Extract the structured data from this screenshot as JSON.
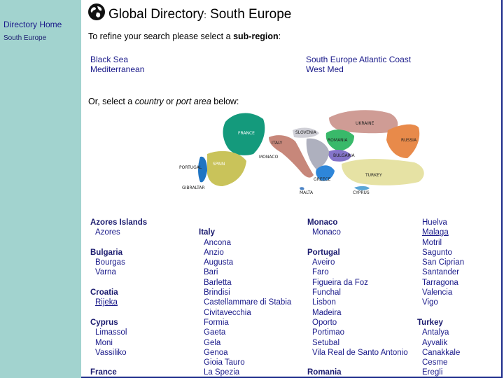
{
  "sidebar": {
    "home_label": "Directory Home",
    "current_label": "South Europe"
  },
  "header": {
    "title_main": "Global Directory",
    "title_sep": ":",
    "title_region": " South Europe"
  },
  "instructions": {
    "subregion_prefix": "To refine your search please select a ",
    "subregion_bold": "sub-region",
    "subregion_suffix": ":",
    "country_prefix": "Or, select a ",
    "country_em1": "country",
    "country_mid": " or ",
    "country_em2": "port area",
    "country_suffix": " below:"
  },
  "subregions": [
    "Black Sea",
    "Mediterranean",
    "South Europe Atlantic Coast",
    "West Med"
  ],
  "map_labels": [
    "UKRAINE",
    "FRANCE",
    "SLOVENIA",
    "ROMANIA",
    "RUSSIA",
    "ITALY",
    "BULGARIA",
    "MONACO",
    "PORTUGAL",
    "SPAIN",
    "GREECE",
    "TURKEY",
    "GIBRALTAR",
    "MALTA",
    "CYPRUS"
  ],
  "columns": [
    [
      {
        "type": "country",
        "text": "Azores Islands"
      },
      {
        "type": "port",
        "text": "Azores"
      },
      {
        "type": "gap"
      },
      {
        "type": "country",
        "text": "Bulgaria"
      },
      {
        "type": "port",
        "text": "Bourgas"
      },
      {
        "type": "port",
        "text": "Varna"
      },
      {
        "type": "gap"
      },
      {
        "type": "country",
        "text": "Croatia"
      },
      {
        "type": "port",
        "text": "Rijeka",
        "underline": true
      },
      {
        "type": "gap"
      },
      {
        "type": "country",
        "text": "Cyprus"
      },
      {
        "type": "port",
        "text": "Limassol"
      },
      {
        "type": "port",
        "text": "Moni"
      },
      {
        "type": "port",
        "text": "Vassiliko"
      },
      {
        "type": "gap"
      },
      {
        "type": "country",
        "text": "France"
      }
    ],
    [
      {
        "type": "gap"
      },
      {
        "type": "country",
        "text": "Italy"
      },
      {
        "type": "port",
        "text": "Ancona"
      },
      {
        "type": "port",
        "text": "Anzio"
      },
      {
        "type": "port",
        "text": "Augusta"
      },
      {
        "type": "port",
        "text": "Bari"
      },
      {
        "type": "port",
        "text": "Barletta"
      },
      {
        "type": "port",
        "text": "Brindisi"
      },
      {
        "type": "port",
        "text": "Castellammare di Stabia"
      },
      {
        "type": "port",
        "text": "Civitavecchia"
      },
      {
        "type": "port",
        "text": "Formia"
      },
      {
        "type": "port",
        "text": "Gaeta"
      },
      {
        "type": "port",
        "text": "Gela"
      },
      {
        "type": "port",
        "text": "Genoa"
      },
      {
        "type": "port",
        "text": "Gioia Tauro"
      },
      {
        "type": "port",
        "text": "La Spezia"
      }
    ],
    [
      {
        "type": "country",
        "text": "Monaco"
      },
      {
        "type": "port",
        "text": "Monaco"
      },
      {
        "type": "gap"
      },
      {
        "type": "country",
        "text": "Portugal"
      },
      {
        "type": "port",
        "text": "Aveiro"
      },
      {
        "type": "port",
        "text": "Faro"
      },
      {
        "type": "port",
        "text": "Figueira da Foz"
      },
      {
        "type": "port",
        "text": "Funchal"
      },
      {
        "type": "port",
        "text": "Lisbon"
      },
      {
        "type": "port",
        "text": "Madeira"
      },
      {
        "type": "port",
        "text": "Oporto"
      },
      {
        "type": "port",
        "text": "Portimao"
      },
      {
        "type": "port",
        "text": "Setubal"
      },
      {
        "type": "port",
        "text": "Vila Real de Santo Antonio"
      },
      {
        "type": "gap"
      },
      {
        "type": "country",
        "text": "Romania"
      }
    ],
    [
      {
        "type": "port",
        "text": "Huelva"
      },
      {
        "type": "port",
        "text": "Malaga",
        "underline": true
      },
      {
        "type": "port",
        "text": "Motril"
      },
      {
        "type": "port",
        "text": "Sagunto"
      },
      {
        "type": "port",
        "text": "San Ciprian"
      },
      {
        "type": "port",
        "text": "Santander"
      },
      {
        "type": "port",
        "text": "Tarragona"
      },
      {
        "type": "port",
        "text": "Valencia"
      },
      {
        "type": "port",
        "text": "Vigo"
      },
      {
        "type": "gap"
      },
      {
        "type": "country",
        "text": "Turkey"
      },
      {
        "type": "port",
        "text": "Antalya"
      },
      {
        "type": "port",
        "text": "Ayvalik"
      },
      {
        "type": "port",
        "text": "Canakkale"
      },
      {
        "type": "port",
        "text": "Cesme"
      },
      {
        "type": "port",
        "text": "Eregli"
      }
    ]
  ],
  "colors": {
    "sidebar": "#a2d3cf",
    "link": "#1a1a8a",
    "frame": "#1b2a8a"
  }
}
